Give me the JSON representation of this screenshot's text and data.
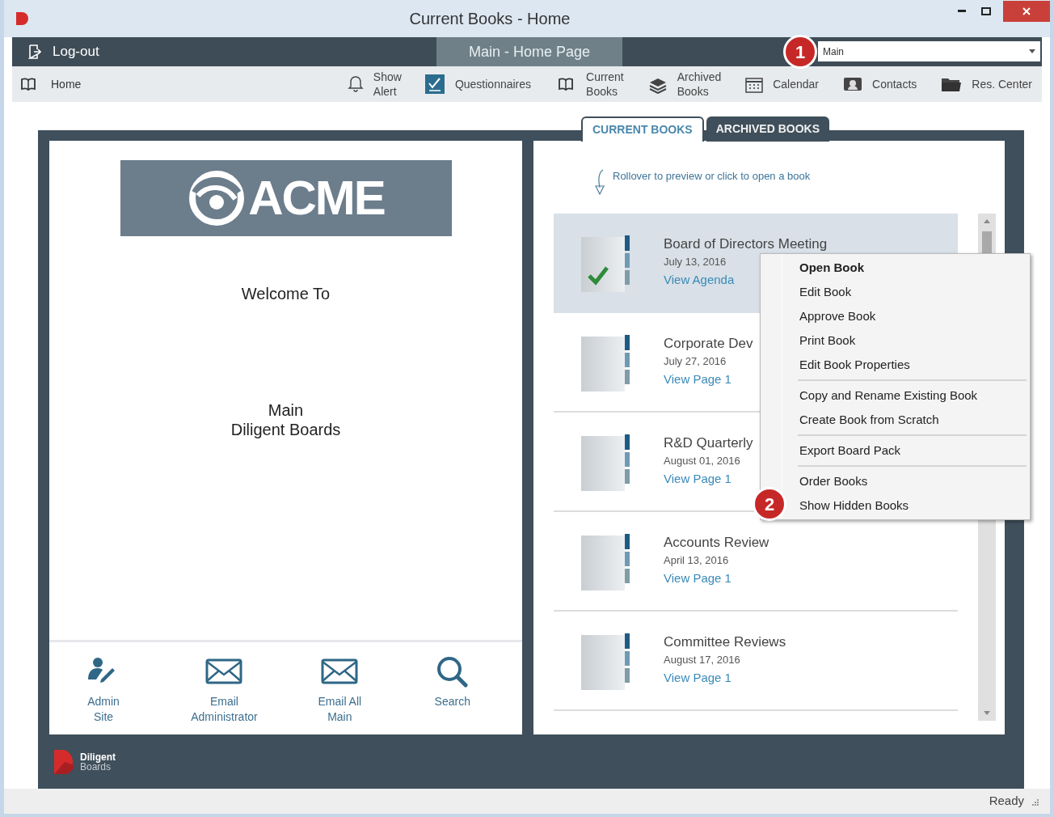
{
  "window": {
    "title": "Current Books - Home"
  },
  "nav": {
    "logout": "Log-out",
    "page_tab": {
      "label": "Main - Home Page",
      "selected": true
    },
    "dropdown": {
      "value": "Main"
    },
    "callout": "1"
  },
  "toolbar": {
    "left": [
      {
        "label": "Home"
      }
    ],
    "right": [
      {
        "label": "Show\nAlert"
      },
      {
        "label": "Questionnaires"
      },
      {
        "label": "Current\nBooks"
      },
      {
        "label": "Archived\nBooks"
      },
      {
        "label": "Calendar"
      },
      {
        "label": "Contacts"
      },
      {
        "label": "Res. Center"
      }
    ]
  },
  "tabs": [
    {
      "label": "CURRENT BOOKS",
      "selected": true
    },
    {
      "label": "ARCHIVED BOOKS",
      "selected": false
    }
  ],
  "home_panel": {
    "logo": "ACME",
    "welcome": "Welcome To",
    "site": "Main\nDiligent Boards",
    "actions": [
      {
        "label": "Admin\nSite"
      },
      {
        "label": "Email\nAdministrator"
      },
      {
        "label": "Email All\nMain"
      },
      {
        "label": "Search"
      }
    ]
  },
  "books_panel": {
    "hint": "Rollover to preview or click to open a book",
    "books": [
      {
        "title": "Board of Directors Meeting",
        "date": "July 13, 2016",
        "link": "View Agenda",
        "selected": true,
        "approved": true
      },
      {
        "title": "Corporate Dev",
        "date": "July 27, 2016",
        "link": "View Page 1",
        "selected": false,
        "approved": false
      },
      {
        "title": "R&D Quarterly",
        "date": "August 01, 2016",
        "link": "View Page 1",
        "selected": false,
        "approved": false
      },
      {
        "title": "Accounts Review",
        "date": "April 13, 2016",
        "link": "View Page 1",
        "selected": false,
        "approved": false
      },
      {
        "title": "Committee Reviews",
        "date": "August 17, 2016",
        "link": "View Page 1",
        "selected": false,
        "approved": false
      }
    ]
  },
  "context_menu": {
    "callout": "2",
    "groups": [
      [
        {
          "label": "Open Book",
          "default": true
        },
        {
          "label": "Edit Book",
          "default": false
        },
        {
          "label": "Approve Book",
          "default": false
        },
        {
          "label": "Print Book",
          "default": false
        },
        {
          "label": "Edit Book Properties",
          "default": false
        }
      ],
      [
        {
          "label": "Copy and Rename Existing Book",
          "default": false
        },
        {
          "label": "Create Book from Scratch",
          "default": false
        }
      ],
      [
        {
          "label": "Export Board Pack",
          "default": false
        }
      ],
      [
        {
          "label": "Order Books",
          "default": false
        },
        {
          "label": "Show Hidden Books",
          "default": false
        }
      ]
    ]
  },
  "footer": {
    "brand": "Diligent",
    "brand_sub": "Boards"
  },
  "status_bar": {
    "text": "Ready"
  }
}
